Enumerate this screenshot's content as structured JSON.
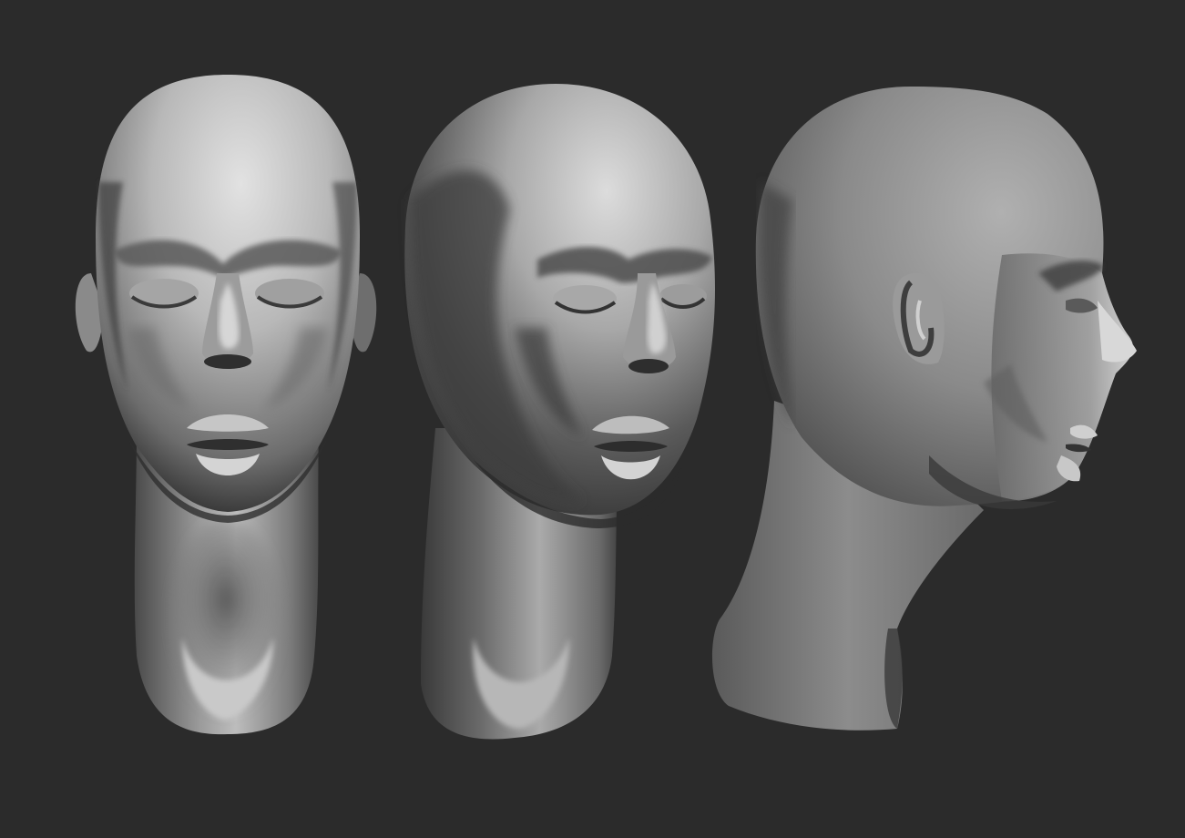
{
  "scene": {
    "background_color": "#2b2b2b",
    "model_base_color": "#8c8c8c",
    "model_highlight_color": "#e6e6e6",
    "model_shadow_color": "#3a3a3a",
    "models": [
      {
        "view": "front",
        "name": "head-front-view"
      },
      {
        "view": "three-quarter",
        "name": "head-three-quarter-view"
      },
      {
        "view": "profile-right",
        "name": "head-profile-view"
      }
    ]
  }
}
